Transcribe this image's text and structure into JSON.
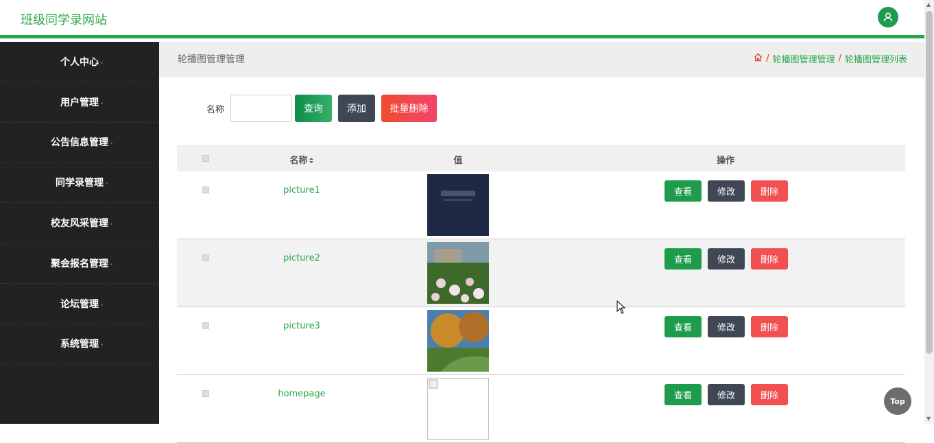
{
  "app": {
    "title": "班级同学录网站"
  },
  "sidebar": {
    "items": [
      {
        "label": "个人中心"
      },
      {
        "label": "用户管理"
      },
      {
        "label": "公告信息管理"
      },
      {
        "label": "同学录管理"
      },
      {
        "label": "校友风采管理"
      },
      {
        "label": "聚会报名管理"
      },
      {
        "label": "论坛管理"
      },
      {
        "label": "系统管理"
      }
    ]
  },
  "header": {
    "title": "轮播图管理管理",
    "breadcrumb": [
      "轮播图管理管理",
      "轮播图管理列表"
    ]
  },
  "search": {
    "label": "名称",
    "value": "",
    "query_label": "查询",
    "add_label": "添加",
    "batch_delete_label": "批量删除"
  },
  "table": {
    "columns": [
      "名称",
      "值",
      "操作"
    ],
    "rows": [
      {
        "name": "picture1"
      },
      {
        "name": "picture2"
      },
      {
        "name": "picture3"
      },
      {
        "name": "homepage"
      }
    ],
    "actions": {
      "view": "查看",
      "edit": "修改",
      "delete": "删除"
    }
  },
  "top_button": "Top",
  "colors": {
    "accent": "#28a745",
    "sidebar": "#222222",
    "danger": "#f14f50",
    "dark": "#3f4654"
  }
}
